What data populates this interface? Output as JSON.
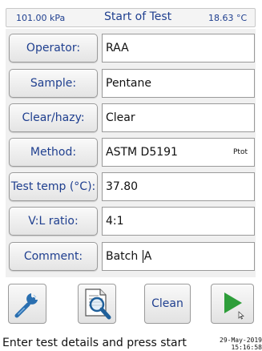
{
  "header": {
    "pressure": "101.00 kPa",
    "title": "Start of Test",
    "temperature": "18.63 °C"
  },
  "form": {
    "operator": {
      "label": "Operator:",
      "value": "RAA"
    },
    "sample": {
      "label": "Sample:",
      "value": "Pentane"
    },
    "clear_hazy": {
      "label": "Clear/hazy:",
      "value": "Clear"
    },
    "method": {
      "label": "Method:",
      "value": "ASTM D5191",
      "suffix": "Ptot"
    },
    "test_temp": {
      "label": "Test temp (°C):",
      "value": "37.80"
    },
    "vl_ratio": {
      "label": "V:L ratio:",
      "value": "4:1"
    },
    "comment": {
      "label": "Comment:",
      "value_before_cursor": "Batch ",
      "value_after_cursor": "A"
    }
  },
  "toolbar": {
    "settings_icon": "wrench-icon",
    "report_icon": "document-search-icon",
    "clean_label": "Clean",
    "start_icon": "play-icon"
  },
  "status": {
    "message": "Enter test details and press start",
    "date": "29-May-2019",
    "time": "15:16:58"
  },
  "colors": {
    "label_text": "#1f3f8f",
    "play_green": "#2e9e3a",
    "icon_blue": "#2a6fb0"
  }
}
